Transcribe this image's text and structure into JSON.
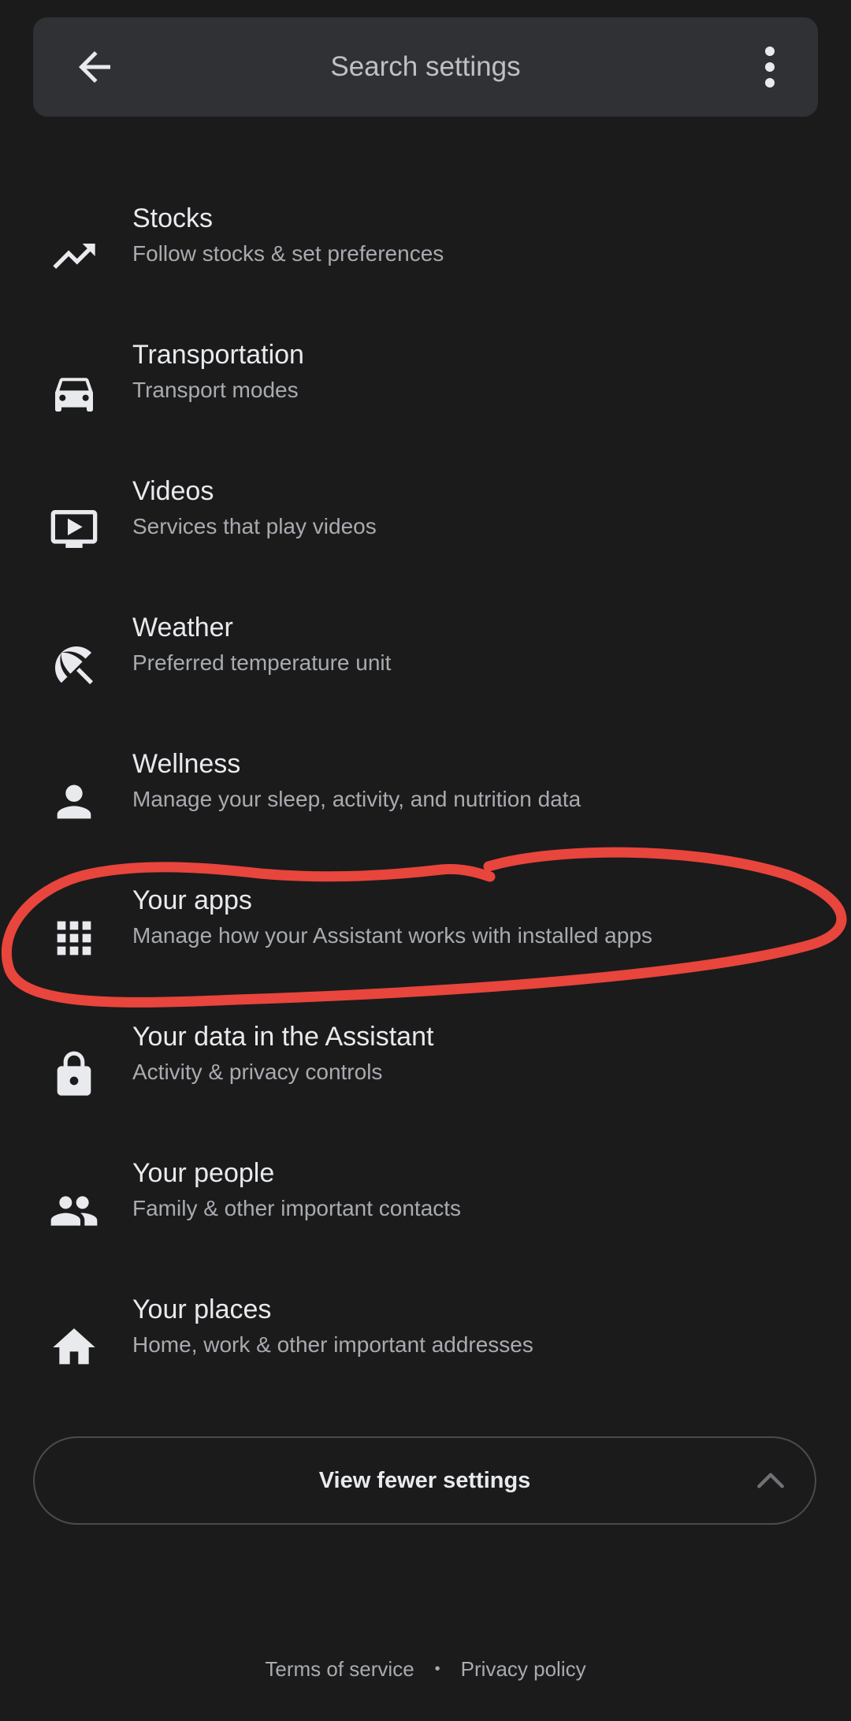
{
  "search": {
    "placeholder": "Search settings"
  },
  "icons": {
    "back": "arrow-left-icon",
    "more": "more-vert-icon"
  },
  "settings": [
    {
      "title": "Stocks",
      "subtitle": "Follow stocks & set preferences",
      "icon": "trending-up-icon"
    },
    {
      "title": "Transportation",
      "subtitle": "Transport modes",
      "icon": "car-icon"
    },
    {
      "title": "Videos",
      "subtitle": "Services that play videos",
      "icon": "video-icon"
    },
    {
      "title": "Weather",
      "subtitle": "Preferred temperature unit",
      "icon": "umbrella-beach-icon"
    },
    {
      "title": "Wellness",
      "subtitle": "Manage your sleep, activity, and nutrition data",
      "icon": "person-icon"
    },
    {
      "title": "Your apps",
      "subtitle": "Manage how your Assistant works with installed apps",
      "icon": "apps-grid-icon"
    },
    {
      "title": "Your data in the Assistant",
      "subtitle": "Activity & privacy controls",
      "icon": "lock-icon"
    },
    {
      "title": "Your people",
      "subtitle": "Family & other important contacts",
      "icon": "people-icon"
    },
    {
      "title": "Your places",
      "subtitle": "Home, work & other important addresses",
      "icon": "home-icon"
    }
  ],
  "fewer_button": {
    "label": "View fewer settings",
    "icon": "chevron-up-icon"
  },
  "footer": {
    "terms": "Terms of service",
    "separator": "•",
    "privacy": "Privacy policy"
  },
  "colors": {
    "background": "#1b1b1c",
    "search_bar": "#303134",
    "annotation": "#e8453c"
  }
}
